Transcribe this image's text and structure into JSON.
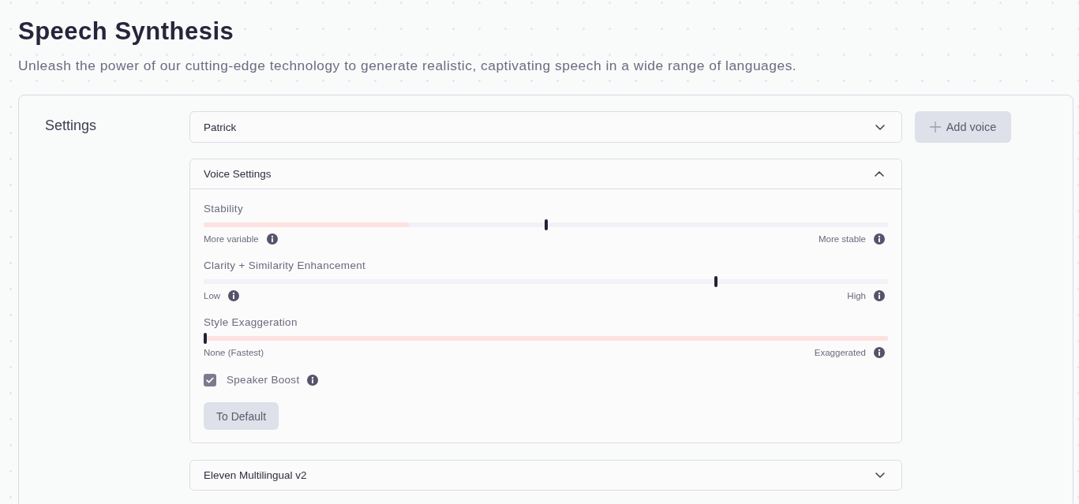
{
  "header": {
    "title": "Speech Synthesis",
    "subtitle": "Unleash the power of our cutting-edge technology to generate realistic, captivating speech in a wide range of languages."
  },
  "settings": {
    "label": "Settings",
    "voice_select": {
      "value": "Patrick"
    },
    "add_voice_button": {
      "label": "Add voice"
    },
    "voice_settings": {
      "title": "Voice Settings",
      "expanded": true,
      "sliders": [
        {
          "label": "Stability",
          "level": 0.5,
          "highlight": {
            "level": 0.3
          },
          "min_label": {
            "text": "More variable",
            "info": true
          },
          "max_label": {
            "text": "More stable",
            "info": true
          }
        },
        {
          "label": "Clarity + Similarity Enhancement",
          "level": 0.75,
          "min_label": {
            "text": "Low",
            "info": true
          },
          "max_label": {
            "text": "High",
            "info": true
          }
        },
        {
          "label": "Style Exaggeration",
          "level": 0,
          "highlight": {
            "level": 1
          },
          "min_label": {
            "text": "None (Fastest)",
            "info": false
          },
          "max_label": {
            "text": "Exaggerated",
            "info": true
          }
        }
      ],
      "speaker_boost": {
        "label": "Speaker Boost",
        "checked": true,
        "info": true
      },
      "default_button": {
        "label": "To Default"
      }
    },
    "model_select": {
      "value": "Eleven Multilingual v2"
    }
  }
}
